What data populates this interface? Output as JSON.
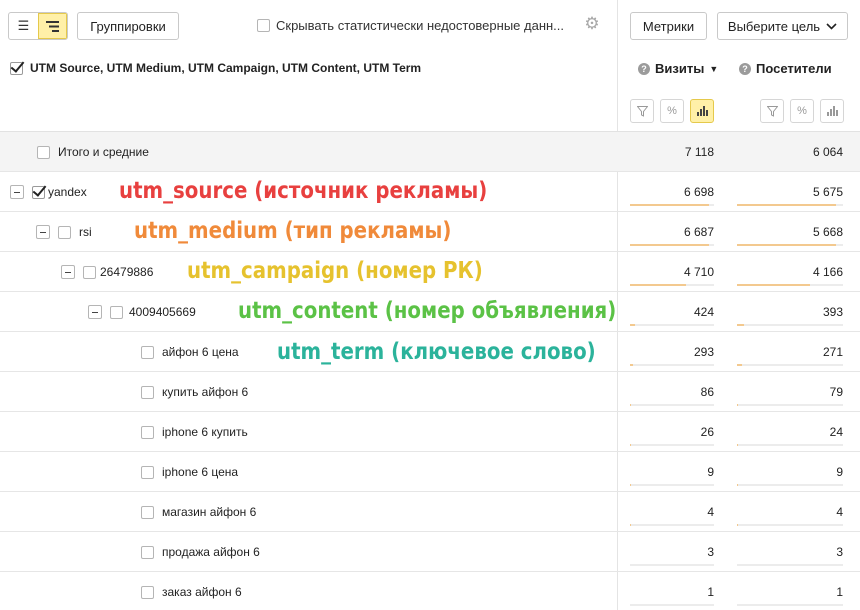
{
  "toolbar": {
    "groupings_label": "Группировки",
    "hide_stats_label": "Скрывать статистически недостоверные данн...",
    "metrics_label": "Метрики",
    "goal_label": "Выберите цель"
  },
  "header": {
    "dimensions_label": "UTM Source, UTM Medium, UTM Campaign, UTM Content, UTM Term",
    "columns": [
      {
        "label": "Визиты",
        "sorted": "desc"
      },
      {
        "label": "Посетители"
      }
    ]
  },
  "colors": {
    "accent": "#fff0a8",
    "bar": "#f3c98f"
  },
  "rows": [
    {
      "name": "Итого и средние",
      "visits": "7 118",
      "visitors": "6 064",
      "visits_share": 1.0,
      "visitors_share": 1.0
    },
    {
      "name": "yandex",
      "visits": "6 698",
      "visitors": "5 675",
      "visits_share": 0.941,
      "visitors_share": 0.936
    },
    {
      "name": "rsi",
      "visits": "6 687",
      "visitors": "5 668",
      "visits_share": 0.939,
      "visitors_share": 0.935
    },
    {
      "name": "26479886",
      "visits": "4 710",
      "visitors": "4 166",
      "visits_share": 0.662,
      "visitors_share": 0.687
    },
    {
      "name": "4009405669",
      "visits": "424",
      "visitors": "393",
      "visits_share": 0.06,
      "visitors_share": 0.065
    },
    {
      "name": "айфон 6 цена",
      "visits": "293",
      "visitors": "271",
      "visits_share": 0.041,
      "visitors_share": 0.045
    },
    {
      "name": "купить айфон 6",
      "visits": "86",
      "visitors": "79",
      "visits_share": 0.012,
      "visitors_share": 0.013
    },
    {
      "name": "iphone 6 купить",
      "visits": "26",
      "visitors": "24",
      "visits_share": 0.004,
      "visitors_share": 0.004
    },
    {
      "name": "iphone 6 цена",
      "visits": "9",
      "visitors": "9",
      "visits_share": 0.001,
      "visitors_share": 0.001
    },
    {
      "name": "магазин айфон 6",
      "visits": "4",
      "visitors": "4",
      "visits_share": 0.001,
      "visitors_share": 0.001
    },
    {
      "name": "продажа айфон 6",
      "visits": "3",
      "visitors": "3",
      "visits_share": 0.0,
      "visitors_share": 0.0
    },
    {
      "name": "заказ айфон 6",
      "visits": "1",
      "visitors": "1",
      "visits_share": 0.0,
      "visitors_share": 0.0
    }
  ],
  "annotations": [
    {
      "text": "utm_source (источник рекламы)",
      "color": "#e8403f"
    },
    {
      "text": "utm_medium (тип рекламы)",
      "color": "#f08a3a"
    },
    {
      "text": "utm_campaign (номер РК)",
      "color": "#e6c22e"
    },
    {
      "text": "utm_content (номер объявления)",
      "color": "#5bc246"
    },
    {
      "text": "utm_term (ключевое слово)",
      "color": "#2bb39b"
    }
  ]
}
